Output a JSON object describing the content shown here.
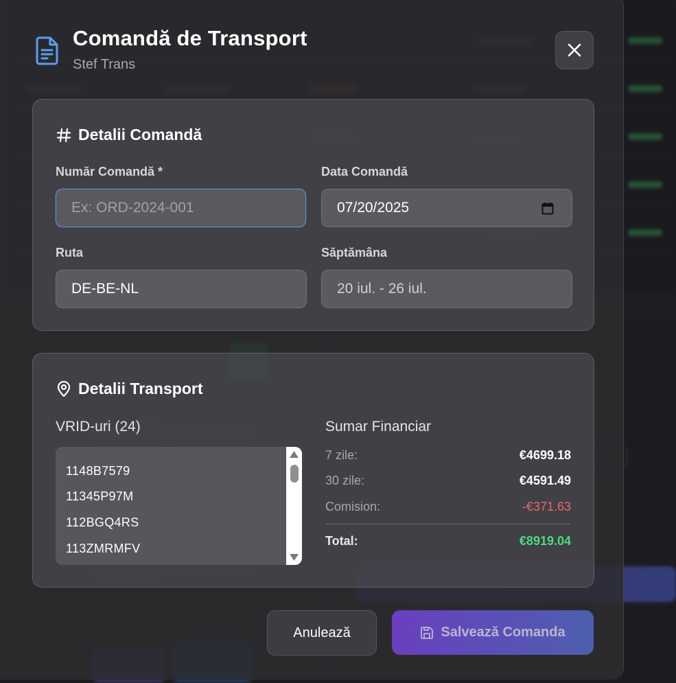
{
  "modal": {
    "title": "Comandă de Transport",
    "subtitle": "Stef Trans",
    "header_icon": "document-icon",
    "close_icon": "close-icon"
  },
  "order_details": {
    "heading": "Detalii Comandă",
    "heading_icon": "hash-icon",
    "order_number": {
      "label": "Număr Comandă *",
      "value": "",
      "placeholder": "Ex: ORD-2024-001"
    },
    "order_date": {
      "label": "Data Comandă",
      "value": "07/20/2025",
      "icon": "calendar-icon"
    },
    "route": {
      "label": "Ruta",
      "value": "DE-BE-NL"
    },
    "week": {
      "label": "Săptămâna",
      "value": "20 iul. - 26 iul."
    }
  },
  "transport_details": {
    "heading": "Detalii Transport",
    "heading_icon": "map-pin-icon",
    "vrid_title": "VRID-uri (24)",
    "vrids": [
      "1148B7579",
      "11345P97M",
      "112BGQ4RS",
      "113ZMRMFV"
    ],
    "summary": {
      "title": "Sumar Financiar",
      "rows": [
        {
          "label": "7 zile:",
          "value": "€4699.18"
        },
        {
          "label": "30 zile:",
          "value": "€4591.49"
        },
        {
          "label": "Comision:",
          "value": "-€371.63"
        }
      ],
      "total_label": "Total:",
      "total_value": "€8919.04"
    }
  },
  "footer": {
    "cancel_label": "Anulează",
    "save_label": "Salvează Comanda",
    "save_icon": "save-icon"
  },
  "colors": {
    "accent_gradient_start": "#6a3fc0",
    "accent_gradient_end": "#4d5fae",
    "total_green": "#4ddb80",
    "negative_red": "#e76a6a",
    "focus_blue": "#5f8ed9",
    "icon_blue": "#5b9ef0"
  }
}
